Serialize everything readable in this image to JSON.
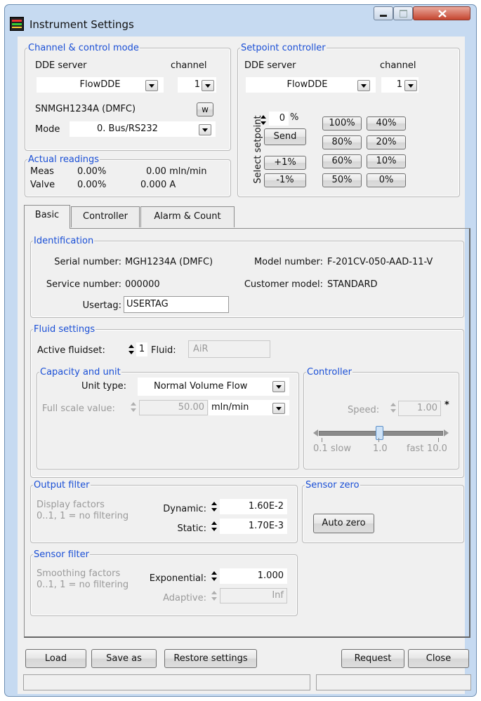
{
  "window": {
    "title": "Instrument Settings"
  },
  "channel": {
    "title": "Channel & control mode",
    "dde_label": "DDE server",
    "channel_label": "channel",
    "dde_value": "FlowDDE",
    "channel_value": "1",
    "serial": "SNMGH1234A (DMFC)",
    "w_label": "w",
    "mode_label": "Mode",
    "mode_value": "0. Bus/RS232"
  },
  "actual": {
    "title": "Actual readings",
    "meas_label": "Meas",
    "meas_pct": "0.00%",
    "meas_flow": "0.00 mln/min",
    "valve_label": "Valve",
    "valve_pct": "0.00%",
    "valve_amp": "0.000 A"
  },
  "setpoint": {
    "title": "Setpoint controller",
    "dde_label": "DDE server",
    "channel_label": "channel",
    "dde_value": "FlowDDE",
    "channel_value": "1",
    "select_label": "Select setpoint",
    "value": "0",
    "unit": "%",
    "send": "Send",
    "plus": "+1%",
    "minus": "-1%",
    "presets": [
      "100%",
      "40%",
      "80%",
      "20%",
      "60%",
      "10%",
      "50%",
      "0%"
    ]
  },
  "tabs": [
    "Basic",
    "Controller",
    "Alarm & Count"
  ],
  "identification": {
    "title": "Identification",
    "serial_label": "Serial number:",
    "serial_value": "MGH1234A (DMFC)",
    "model_label": "Model number:",
    "model_value": "F-201CV-050-AAD-11-V",
    "service_label": "Service number:",
    "service_value": "000000",
    "customer_label": "Customer model:",
    "customer_value": "STANDARD",
    "usertag_label": "Usertag:",
    "usertag_value": "USERTAG"
  },
  "fluid": {
    "title": "Fluid settings",
    "active_label": "Active fluidset:",
    "active_value": "1",
    "fluid_label": "Fluid:",
    "fluid_value": "AiR"
  },
  "capacity": {
    "title": "Capacity and unit",
    "unit_type_label": "Unit type:",
    "unit_type_value": "Normal Volume Flow",
    "fsv_label": "Full scale value:",
    "fsv_value": "50.00",
    "fsv_unit": "mln/min"
  },
  "controller": {
    "title": "Controller",
    "speed_label": "Speed:",
    "speed_value": "1.00",
    "star": "*",
    "slider_min": "0.1",
    "slider_slow": "slow",
    "slider_mid": "1.0",
    "slider_fast": "fast",
    "slider_max": "10.0",
    "slider_value": 1.0
  },
  "output_filter": {
    "title": "Output filter",
    "desc1": "Display factors",
    "desc2": "0..1, 1 = no filtering",
    "dynamic_label": "Dynamic:",
    "dynamic_value": "1.60E-2",
    "static_label": "Static:",
    "static_value": "1.70E-3"
  },
  "sensor_zero": {
    "title": "Sensor zero",
    "button": "Auto zero"
  },
  "sensor_filter": {
    "title": "Sensor filter",
    "desc1": "Smoothing factors",
    "desc2": "0..1, 1 = no filtering",
    "exp_label": "Exponential:",
    "exp_value": "1.000",
    "adaptive_label": "Adaptive:",
    "adaptive_value": "Inf"
  },
  "footer": {
    "load": "Load",
    "save_as": "Save as",
    "restore": "Restore settings",
    "request": "Request",
    "close": "Close"
  }
}
